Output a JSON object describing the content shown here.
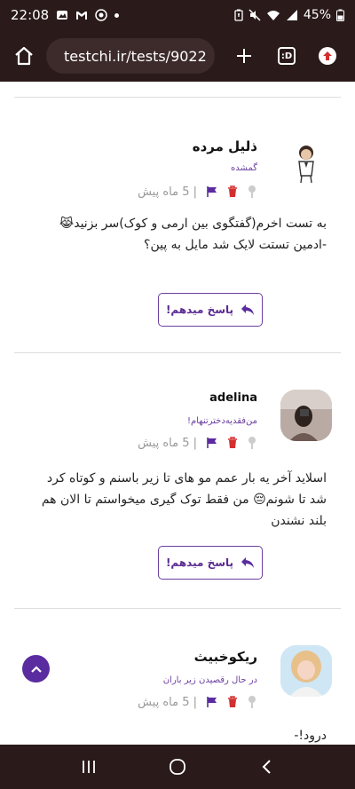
{
  "status_bar": {
    "time": "22:08",
    "battery": "45%"
  },
  "browser": {
    "url": "testchi.ir/tests/9022",
    "tab_count": ":D"
  },
  "comments": [
    {
      "author": "ذلیل مرده",
      "subtitle": "گمشده",
      "time": "| 5 ماه پیش",
      "body": "به تست اخرم(گفتگوی بین ارمی و کوک)سر بزنید😹\n-ادمین تستت لایک شد مایل به پین؟",
      "reply_label": "پاسخ میدهم!"
    },
    {
      "author": "adelina",
      "subtitle": "من‌فقدیه‌دخترتنهام!",
      "time": "| 5 ماه پیش",
      "body": "اسلاید آخر یه بار عمم مو های تا زیر باسنم و کوتاه کرد شد تا شونم😔 من فقط توک گیری میخواستم تا الان هم بلند نشندن",
      "reply_label": "پاسخ میدهم!"
    },
    {
      "author": "ریکوخبیث",
      "subtitle": "در حال رقصیدن زیر باران",
      "time": "| 5 ماه پیش",
      "body": "درود!-"
    }
  ],
  "colors": {
    "accent": "#6b3fa0",
    "chrome": "#2a1a1a"
  }
}
